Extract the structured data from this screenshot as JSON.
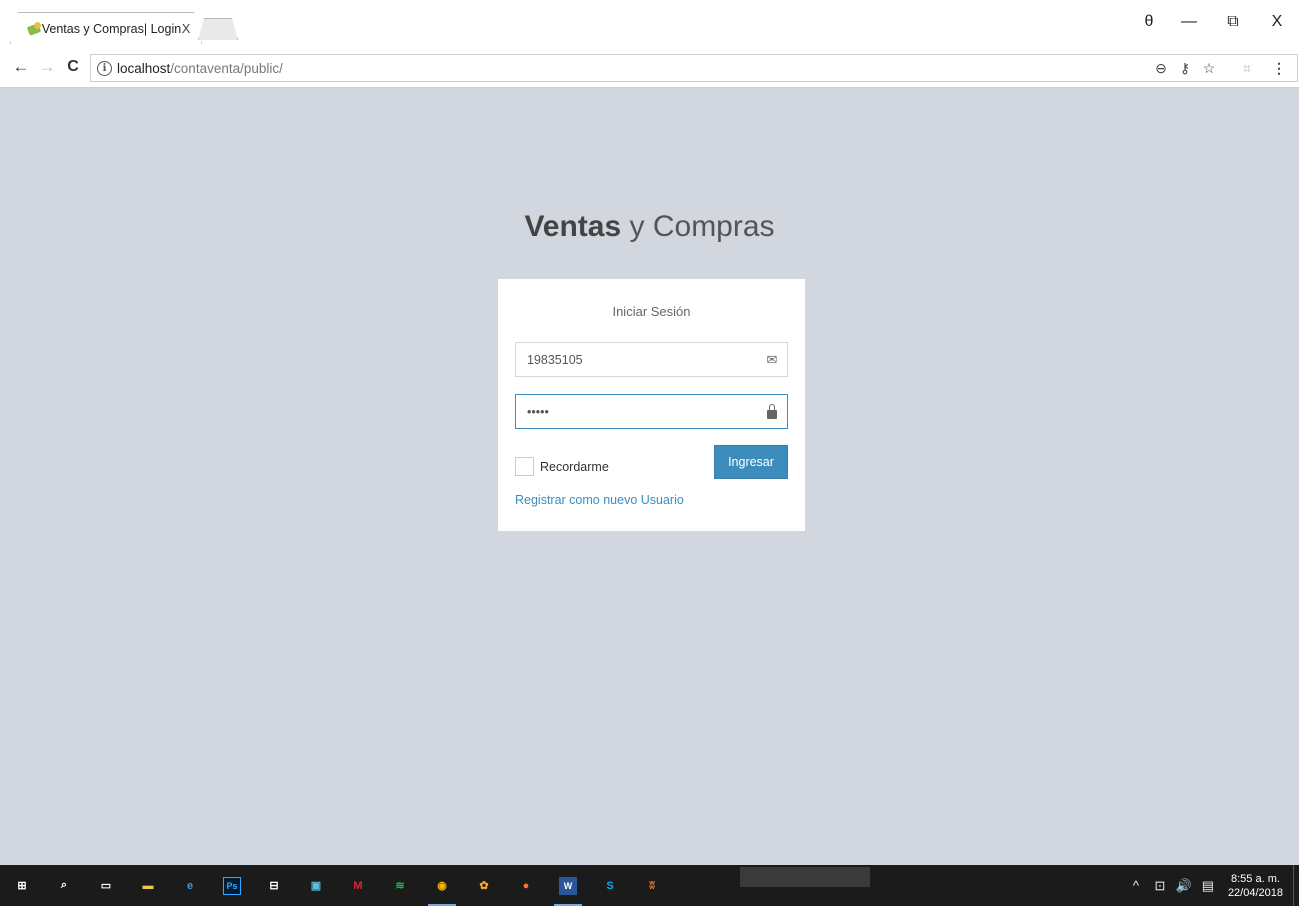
{
  "browser": {
    "tab_title": "Ventas y Compras| Login",
    "tab_close": "X",
    "url_host": "localhost",
    "url_path": "/contaventa/public/",
    "info_glyph": "i",
    "nav": {
      "back": "←",
      "forward": "→",
      "reload": "C"
    },
    "window": {
      "profile": "θ",
      "minimize": "—",
      "restore": "⧉",
      "close": "X"
    },
    "omnibox_icons": {
      "zoom": "⊖",
      "key": "⚷",
      "star": "☆",
      "extension": "⌗",
      "menu": "⋮"
    }
  },
  "login": {
    "logo_bold": "Ventas",
    "logo_rest": " y Compras",
    "box_message": "Iniciar Sesión",
    "username_value": "19835105",
    "password_value": "•••••",
    "remember_label": "Recordarme",
    "submit_label": "Ingresar",
    "register_link": "Registrar como nuevo Usuario",
    "accent_color": "#3c8dbc",
    "background_color": "#d2d6de"
  },
  "taskbar": {
    "apps": [
      {
        "name": "windows-start-icon",
        "glyph": "⊞",
        "color": "#ffffff"
      },
      {
        "name": "search-icon",
        "glyph": "⌕",
        "color": "#ffffff"
      },
      {
        "name": "task-view-icon",
        "glyph": "▭",
        "color": "#ffffff"
      },
      {
        "name": "file-explorer-icon",
        "glyph": "▬",
        "color": "#f2c84b"
      },
      {
        "name": "edge-icon",
        "glyph": "e",
        "color": "#3b9ae1"
      },
      {
        "name": "photoshop-icon",
        "glyph": "Ps",
        "color": "#31a8ff"
      },
      {
        "name": "store-icon",
        "glyph": "⊟",
        "color": "#ffffff"
      },
      {
        "name": "media-icon",
        "glyph": "▣",
        "color": "#5bc0de"
      },
      {
        "name": "mega-icon",
        "glyph": "M",
        "color": "#d9272e"
      },
      {
        "name": "spotify-icon",
        "glyph": "≋",
        "color": "#1db954"
      },
      {
        "name": "chrome-icon",
        "glyph": "◉",
        "color": "#f4b400"
      },
      {
        "name": "fl-studio-icon",
        "glyph": "✿",
        "color": "#f7a928"
      },
      {
        "name": "firefox-icon",
        "glyph": "●",
        "color": "#ff7139"
      },
      {
        "name": "word-icon",
        "glyph": "W",
        "color": "#2b579a"
      },
      {
        "name": "skype-icon",
        "glyph": "S",
        "color": "#00aff0"
      },
      {
        "name": "xampp-icon",
        "glyph": "ʬ",
        "color": "#fb7a24"
      }
    ],
    "tray_up": "^",
    "tray_network": "⊡",
    "tray_volume": "🔊",
    "tray_notifications": "▤",
    "time": "8:55 a. m.",
    "date": "22/04/2018"
  }
}
